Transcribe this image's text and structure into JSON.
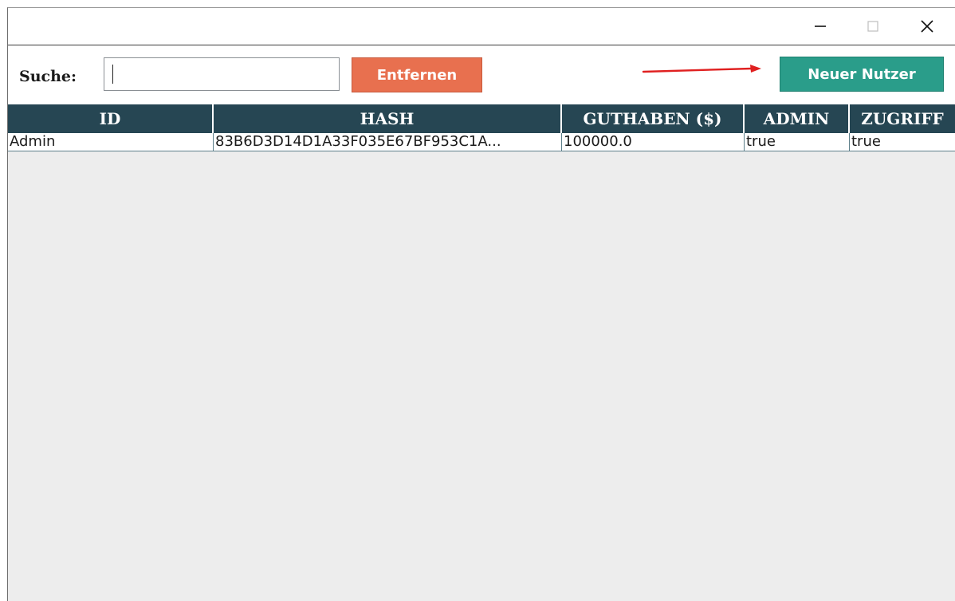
{
  "window": {
    "controls": {
      "minimize": "minimize-icon",
      "maximize": "maximize-icon",
      "close": "close-icon"
    }
  },
  "toolbar": {
    "search_label": "Suche:",
    "search_value": "",
    "remove_label": "Entfernen",
    "new_user_label": "Neuer Nutzer"
  },
  "colors": {
    "header_bg": "#264653",
    "remove_button": "#e8704f",
    "new_user_button": "#2a9d8a",
    "arrow": "#e02020",
    "table_bg": "#ededed"
  },
  "table": {
    "columns": [
      "ID",
      "HASH",
      "GUTHABEN ($)",
      "ADMIN",
      "ZUGRIFF"
    ],
    "rows": [
      [
        "Admin",
        "83B6D3D14D1A33F035E67BF953C1A...",
        "100000.0",
        "true",
        "true"
      ]
    ]
  }
}
